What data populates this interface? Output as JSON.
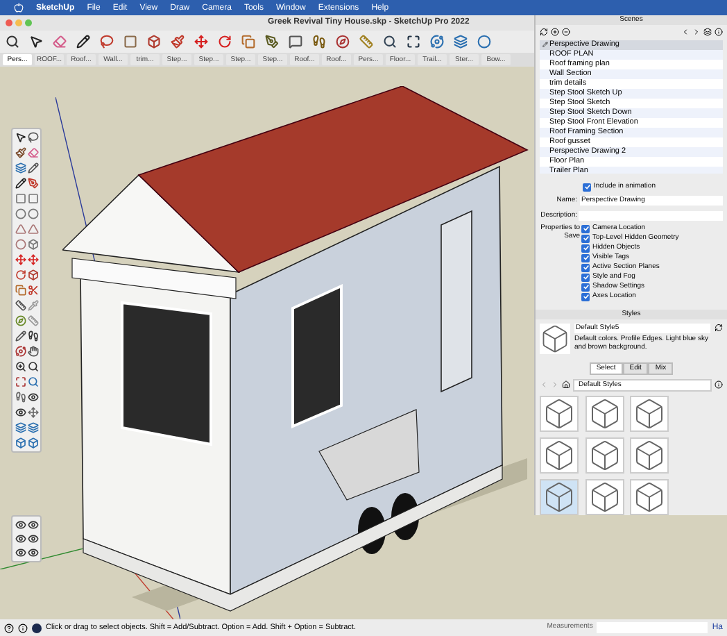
{
  "menu_bar": {
    "items": [
      "SketchUp",
      "File",
      "Edit",
      "View",
      "Draw",
      "Camera",
      "Tools",
      "Window",
      "Extensions",
      "Help"
    ]
  },
  "window": {
    "title": "Greek Revival Tiny House.skp - SketchUp Pro 2022"
  },
  "scene_tabs": [
    {
      "label": "Pers...",
      "selected": true
    },
    {
      "label": "ROOF...",
      "selected": false
    },
    {
      "label": "Roof...",
      "selected": false
    },
    {
      "label": "Wall...",
      "selected": false
    },
    {
      "label": "trim...",
      "selected": false
    },
    {
      "label": "Step...",
      "selected": false
    },
    {
      "label": "Step...",
      "selected": false
    },
    {
      "label": "Step...",
      "selected": false
    },
    {
      "label": "Step...",
      "selected": false
    },
    {
      "label": "Roof...",
      "selected": false
    },
    {
      "label": "Roof...",
      "selected": false
    },
    {
      "label": "Pers...",
      "selected": false
    },
    {
      "label": "Floor...",
      "selected": false
    },
    {
      "label": "Trail...",
      "selected": false
    },
    {
      "label": "Ster...",
      "selected": false
    },
    {
      "label": "Bow...",
      "selected": false
    }
  ],
  "scenes_panel": {
    "title": "Scenes",
    "scenes": [
      {
        "name": "Perspective Drawing",
        "selected": true
      },
      {
        "name": "ROOF PLAN",
        "selected": false
      },
      {
        "name": "Roof framing plan",
        "selected": false
      },
      {
        "name": "Wall Section",
        "selected": false
      },
      {
        "name": "trim details",
        "selected": false
      },
      {
        "name": "Step Stool Sketch Up",
        "selected": false
      },
      {
        "name": "Step Stool Sketch",
        "selected": false
      },
      {
        "name": "Step Stool Sketch Down",
        "selected": false
      },
      {
        "name": "Step Stool Front Elevation",
        "selected": false
      },
      {
        "name": "Roof Framing Section",
        "selected": false
      },
      {
        "name": "Roof gusset",
        "selected": false
      },
      {
        "name": "Perspective Drawing 2",
        "selected": false
      },
      {
        "name": "Floor Plan",
        "selected": false
      },
      {
        "name": "Trailer Plan",
        "selected": false
      }
    ],
    "include_in_animation": {
      "label": "Include in animation",
      "checked": true
    },
    "name_field": {
      "label": "Name:",
      "value": "Perspective Drawing"
    },
    "description_field": {
      "label": "Description:"
    },
    "properties_to_save": {
      "label": "Properties to Save",
      "options": [
        {
          "label": "Camera Location",
          "checked": true
        },
        {
          "label": "Top-Level Hidden Geometry",
          "checked": true
        },
        {
          "label": "Hidden Objects",
          "checked": true
        },
        {
          "label": "Visible Tags",
          "checked": true
        },
        {
          "label": "Active Section Planes",
          "checked": true
        },
        {
          "label": "Style and Fog",
          "checked": true
        },
        {
          "label": "Shadow Settings",
          "checked": true
        },
        {
          "label": "Axes Location",
          "checked": true
        }
      ]
    }
  },
  "styles_panel": {
    "title": "Styles",
    "style_name": "Default Style5",
    "style_description": "Default colors. Profile Edges. Light blue sky and brown background.",
    "tabs": [
      {
        "label": "Select",
        "selected": true
      },
      {
        "label": "Edit",
        "selected": false
      },
      {
        "label": "Mix",
        "selected": false
      }
    ],
    "library": "Default Styles"
  },
  "status_bar": {
    "message": "Click or drag to select objects. Shift = Add/Subtract. Option = Add. Shift + Option = Subtract.",
    "measurements_label": "Measurements",
    "edge_text": "Ha"
  }
}
